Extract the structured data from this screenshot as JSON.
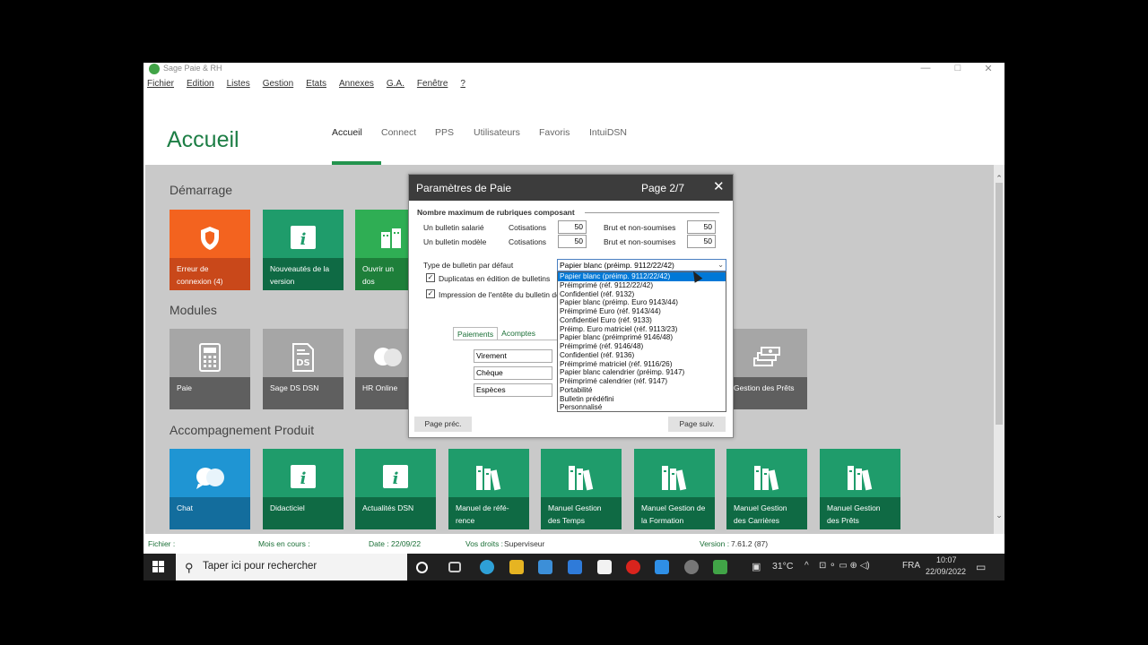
{
  "window": {
    "title": "Sage Paie & RH",
    "controls": [
      "—",
      "□",
      "✕"
    ]
  },
  "menu": [
    "Fichier",
    "Edition",
    "Listes",
    "Gestion",
    "Etats",
    "Annexes",
    "G.A.",
    "Fenêtre",
    "?"
  ],
  "header": {
    "title": "Accueil",
    "tabs": [
      "Accueil",
      "Connect",
      "PPS",
      "Utilisateurs",
      "Favoris",
      "IntuiDSN"
    ],
    "active_tab": "Accueil",
    "accent": "#23944e"
  },
  "sections": {
    "demarrage": {
      "title": "Démarrage",
      "tiles": [
        {
          "label": "Erreur de connexion (4)",
          "icon": "shield-icon",
          "color": "#f3631f"
        },
        {
          "label": "Nouveautés de la version",
          "icon": "info-icon",
          "color": "#1f9c6b"
        },
        {
          "label": "Ouvrir un dos",
          "icon": "building-icon",
          "color": "#2fae54"
        }
      ]
    },
    "modules": {
      "title": "Modules",
      "tiles": [
        {
          "label": "Paie",
          "icon": "calculator-icon"
        },
        {
          "label": "Sage DS DSN",
          "icon": "ds-document-icon"
        },
        {
          "label": "HR Online",
          "icon": "chat-bubbles-icon"
        },
        {
          "label": "Gestion des Prêts",
          "icon": "money-stack-icon"
        }
      ]
    },
    "accompagnement": {
      "title": "Accompagnement Produit",
      "tiles": [
        {
          "label": "Chat",
          "icon": "chat-icon"
        },
        {
          "label": "Didacticiel",
          "icon": "info-icon"
        },
        {
          "label": "Actualités DSN",
          "icon": "info-icon"
        },
        {
          "label": "Manuel de réfé-rence",
          "icon": "books-icon"
        },
        {
          "label": "Manuel Gestion des Temps",
          "icon": "books-icon"
        },
        {
          "label": "Manuel Gestion de la Formation",
          "icon": "books-icon"
        },
        {
          "label": "Manuel Gestion des Carrières",
          "icon": "books-icon"
        },
        {
          "label": "Manuel Gestion des Prêts",
          "icon": "books-icon"
        }
      ]
    }
  },
  "statusbar": {
    "fichier_label": "Fichier :",
    "fichier_value": "",
    "mois_label": "Mois en cours :",
    "mois_value": "",
    "date_label": "Date :",
    "date_value": "22/09/22",
    "droits_label": "Vos droits :",
    "droits_value": "Superviseur",
    "version_label": "Version :",
    "version_value": "7.61.2 (87)"
  },
  "taskbar": {
    "search_placeholder": "Taper ici pour rechercher",
    "weather": "31°C",
    "lang": "FRA",
    "time": "10:07",
    "date": "22/09/2022"
  },
  "dialog": {
    "title": "Paramètres de Paie",
    "page": "Page 2/7",
    "section_title": "Nombre maximum de rubriques composant",
    "rows": [
      {
        "label": "Un bulletin salarié",
        "cot_label": "Cotisations",
        "cot_value": "50",
        "brut_label": "Brut et non-soumises",
        "brut_value": "50"
      },
      {
        "label": "Un bulletin modèle",
        "cot_label": "Cotisations",
        "cot_value": "50",
        "brut_label": "Brut et non-soumises",
        "brut_value": "50"
      }
    ],
    "type_label": "Type de bulletin par défaut",
    "type_value": "Papier blanc (préimp. 9112/22/42)",
    "checkbox_duplicatas": "Duplicatas en édition de bulletins",
    "checkbox_impression": "Impression de l'entête du bulletin de",
    "tabs": [
      "Paiements",
      "Acomptes"
    ],
    "payments": [
      "Virement",
      "Chèque",
      "Espèces"
    ],
    "options": [
      "Papier blanc (préimp. 9112/22/42)",
      "Préimprimé   (réf. 9112/22/42)",
      "Confidentiel (réf. 9132)",
      "Papier blanc (préimp. Euro 9143/44)",
      "Préimprimé Euro (réf. 9143/44)",
      "Confidentiel Euro (réf. 9133)",
      "Préimp. Euro matriciel (réf. 9113/23)",
      "Papier blanc (préimprimé 9146/48)",
      "Préimprimé (réf. 9146/48)",
      "Confidentiel (réf. 9136)",
      "Préimprimé matriciel (réf. 9116/26)",
      "Papier blanc calendrier (préimp. 9147)",
      "Préimprimé calendrier (réf. 9147)",
      "Portabilité",
      "Bulletin prédéfini",
      "Personnalisé"
    ],
    "btn_prev": "Page préc.",
    "btn_next": "Page suiv."
  }
}
